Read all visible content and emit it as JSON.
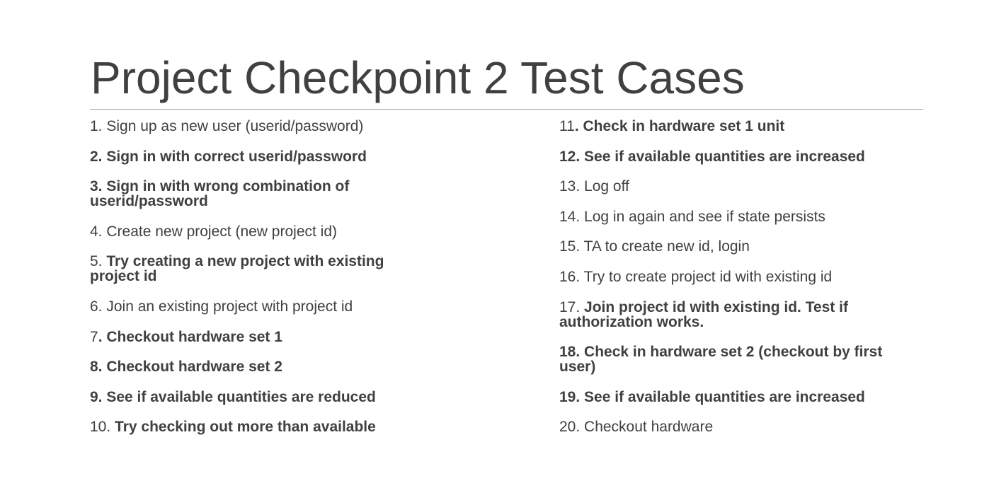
{
  "title": "Project Checkpoint 2 Test Cases",
  "left_column": [
    {
      "number": "1. ",
      "text": "Sign up as new user (userid/password)",
      "bold": false,
      "number_bold": false
    },
    {
      "number": "2. ",
      "text": "Sign in with correct userid/password",
      "bold": true,
      "number_bold": true
    },
    {
      "number": "3. ",
      "text": "Sign in with wrong combination of userid/password",
      "bold": true,
      "number_bold": true
    },
    {
      "number": "4. ",
      "text": "Create new project (new project id)",
      "bold": false,
      "number_bold": false
    },
    {
      "number": "5. ",
      "text": "Try creating a new project with existing project id",
      "bold": true,
      "number_bold": false
    },
    {
      "number": "6. ",
      "text": "Join an existing project with project id",
      "bold": false,
      "number_bold": false
    },
    {
      "number": "7",
      "text": ". Checkout hardware set 1",
      "bold": true,
      "number_bold": false
    },
    {
      "number": "8. ",
      "text": "Checkout hardware set 2",
      "bold": true,
      "number_bold": true
    },
    {
      "number": "9. ",
      "text": "See if available quantities are reduced",
      "bold": true,
      "number_bold": true
    },
    {
      "number": "10. ",
      "text": "Try checking out more than available",
      "bold": true,
      "number_bold": false
    }
  ],
  "right_column": [
    {
      "number": "11",
      "text": ". Check in hardware set 1 unit",
      "bold": true,
      "number_bold": false
    },
    {
      "number": "12. ",
      "text": "See if available quantities are increased",
      "bold": true,
      "number_bold": true
    },
    {
      "number": "13. ",
      "text": "Log off",
      "bold": false,
      "number_bold": false
    },
    {
      "number": "14. ",
      "text": "Log in again and see if state persists",
      "bold": false,
      "number_bold": false
    },
    {
      "number": "15. ",
      "text": "TA to create new id, login",
      "bold": false,
      "number_bold": false
    },
    {
      "number": "16. ",
      "text": "Try to create project id with existing id",
      "bold": false,
      "number_bold": false
    },
    {
      "number": "17. ",
      "text": "Join project id with existing id. Test if authorization works.",
      "bold": true,
      "number_bold": false
    },
    {
      "number": "18. ",
      "text": "Check in hardware set 2 (checkout by first user)",
      "bold": true,
      "number_bold": true
    },
    {
      "number": "19. ",
      "text": "See if available quantities are increased",
      "bold": true,
      "number_bold": true
    },
    {
      "number": "20. ",
      "text": "Checkout hardware",
      "bold": false,
      "number_bold": false
    }
  ]
}
